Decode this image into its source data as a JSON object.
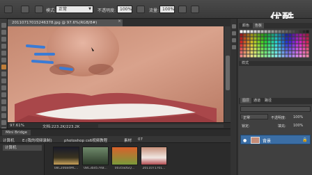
{
  "options_bar": {
    "mode_label": "模式:",
    "mode_value": "正常",
    "opacity_label": "不透明度:",
    "opacity_value": "100%",
    "flow_label": "流量:",
    "flow_value": "100%"
  },
  "watermark": "优酷",
  "document": {
    "tab_title": "20110717015246378.jpg @ 97.6%(RGB/8#)",
    "close_glyph": "×"
  },
  "status_bar": {
    "zoom": "97.61%",
    "doc_info": "文档:223.2K/223.2K"
  },
  "mini_bridge": {
    "tab_label": "Mini Bridge",
    "path": [
      "计算机",
      "E:(我的视频录制)",
      "photoshop cs6视频教程",
      "素材",
      "07"
    ],
    "tree_item": "计算机",
    "thumbnails": [
      {
        "label": "08C20684MC..."
      },
      {
        "label": "08C3bd57RB..."
      },
      {
        "label": "0035S0GQ..."
      },
      {
        "label": "2011071701..."
      }
    ]
  },
  "right_panels": {
    "swatch_tabs": [
      "颜色",
      "色板"
    ],
    "styles_header": "样式",
    "layers_tabs": [
      "图层",
      "通道",
      "路径"
    ],
    "blend_mode": "正常",
    "opacity_label": "不透明度:",
    "opacity_value": "100%",
    "lock_label": "锁定:",
    "fill_label": "填充:",
    "fill_value": "100%",
    "layer_name": "背景",
    "eye_glyph": "●",
    "lock_glyph": "🔒"
  },
  "colors": {
    "accent_selection": "#3b6ea5",
    "brush_stroke": "#3a7bd5",
    "ui_dark": "#282828"
  }
}
